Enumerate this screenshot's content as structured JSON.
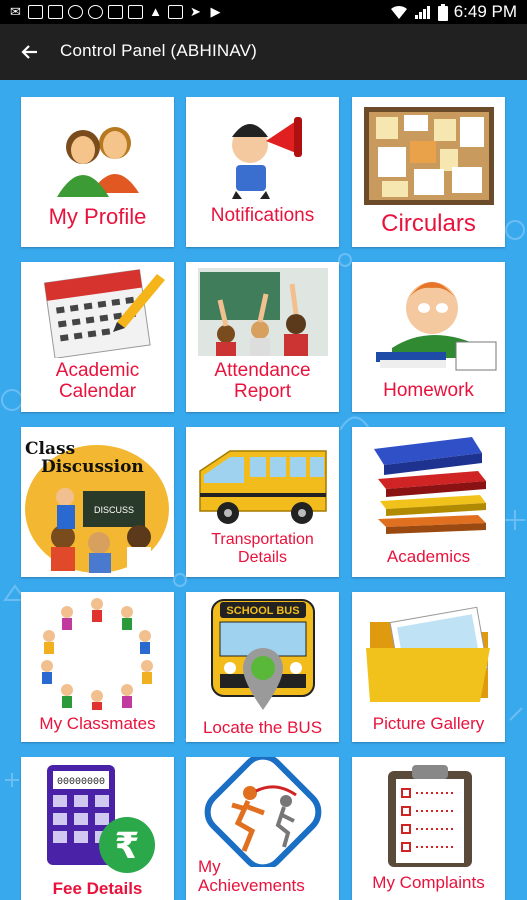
{
  "status_bar": {
    "time": "6:49 PM",
    "left_icons": [
      "email-icon",
      "image-icon",
      "mail-icon",
      "record-icon",
      "sync-icon",
      "mail-icon",
      "mail-icon",
      "warning-icon",
      "mail-icon",
      "send-icon",
      "play-store-icon"
    ],
    "right_icons": [
      "wifi-icon",
      "signal-icon",
      "battery-icon"
    ]
  },
  "app_bar": {
    "title": "Control Panel (ABHINAV)",
    "back_icon": "arrow-left-icon"
  },
  "colors": {
    "background": "#39a9ee",
    "app_bar": "#212121",
    "label": "#e8123c"
  },
  "tiles": [
    {
      "label": "My Profile",
      "icon": "users-icon"
    },
    {
      "label": "Notifications",
      "icon": "megaphone-icon"
    },
    {
      "label": "Circulars",
      "icon": "corkboard-icon"
    },
    {
      "label_lines": [
        "Academic",
        "Calendar"
      ],
      "icon": "calendar-icon"
    },
    {
      "label_lines": [
        "Attendance",
        "Report"
      ],
      "icon": "classroom-icon"
    },
    {
      "label": "Homework",
      "icon": "student-studying-icon"
    },
    {
      "art_text_lines": [
        "Class",
        "Discussion"
      ],
      "art_board_text": "DISCUSS",
      "icon": "class-discussion-icon"
    },
    {
      "label_lines": [
        "Transportation",
        "Details"
      ],
      "icon": "bus-icon"
    },
    {
      "label": "Academics",
      "icon": "books-icon"
    },
    {
      "label": "My Classmates",
      "icon": "kids-circle-icon"
    },
    {
      "label": "Locate the BUS",
      "art_text": "SCHOOL BUS",
      "icon": "bus-location-icon"
    },
    {
      "label": "Picture Gallery",
      "icon": "photo-folder-icon"
    },
    {
      "label": "Fee Details",
      "art_text": "00000000",
      "art_symbol": "₹",
      "icon": "calculator-rupee-icon"
    },
    {
      "label_lines": [
        "My",
        "Achievements"
      ],
      "icon": "trophy-runner-icon"
    },
    {
      "label": "My Complaints",
      "icon": "clipboard-icon"
    }
  ]
}
